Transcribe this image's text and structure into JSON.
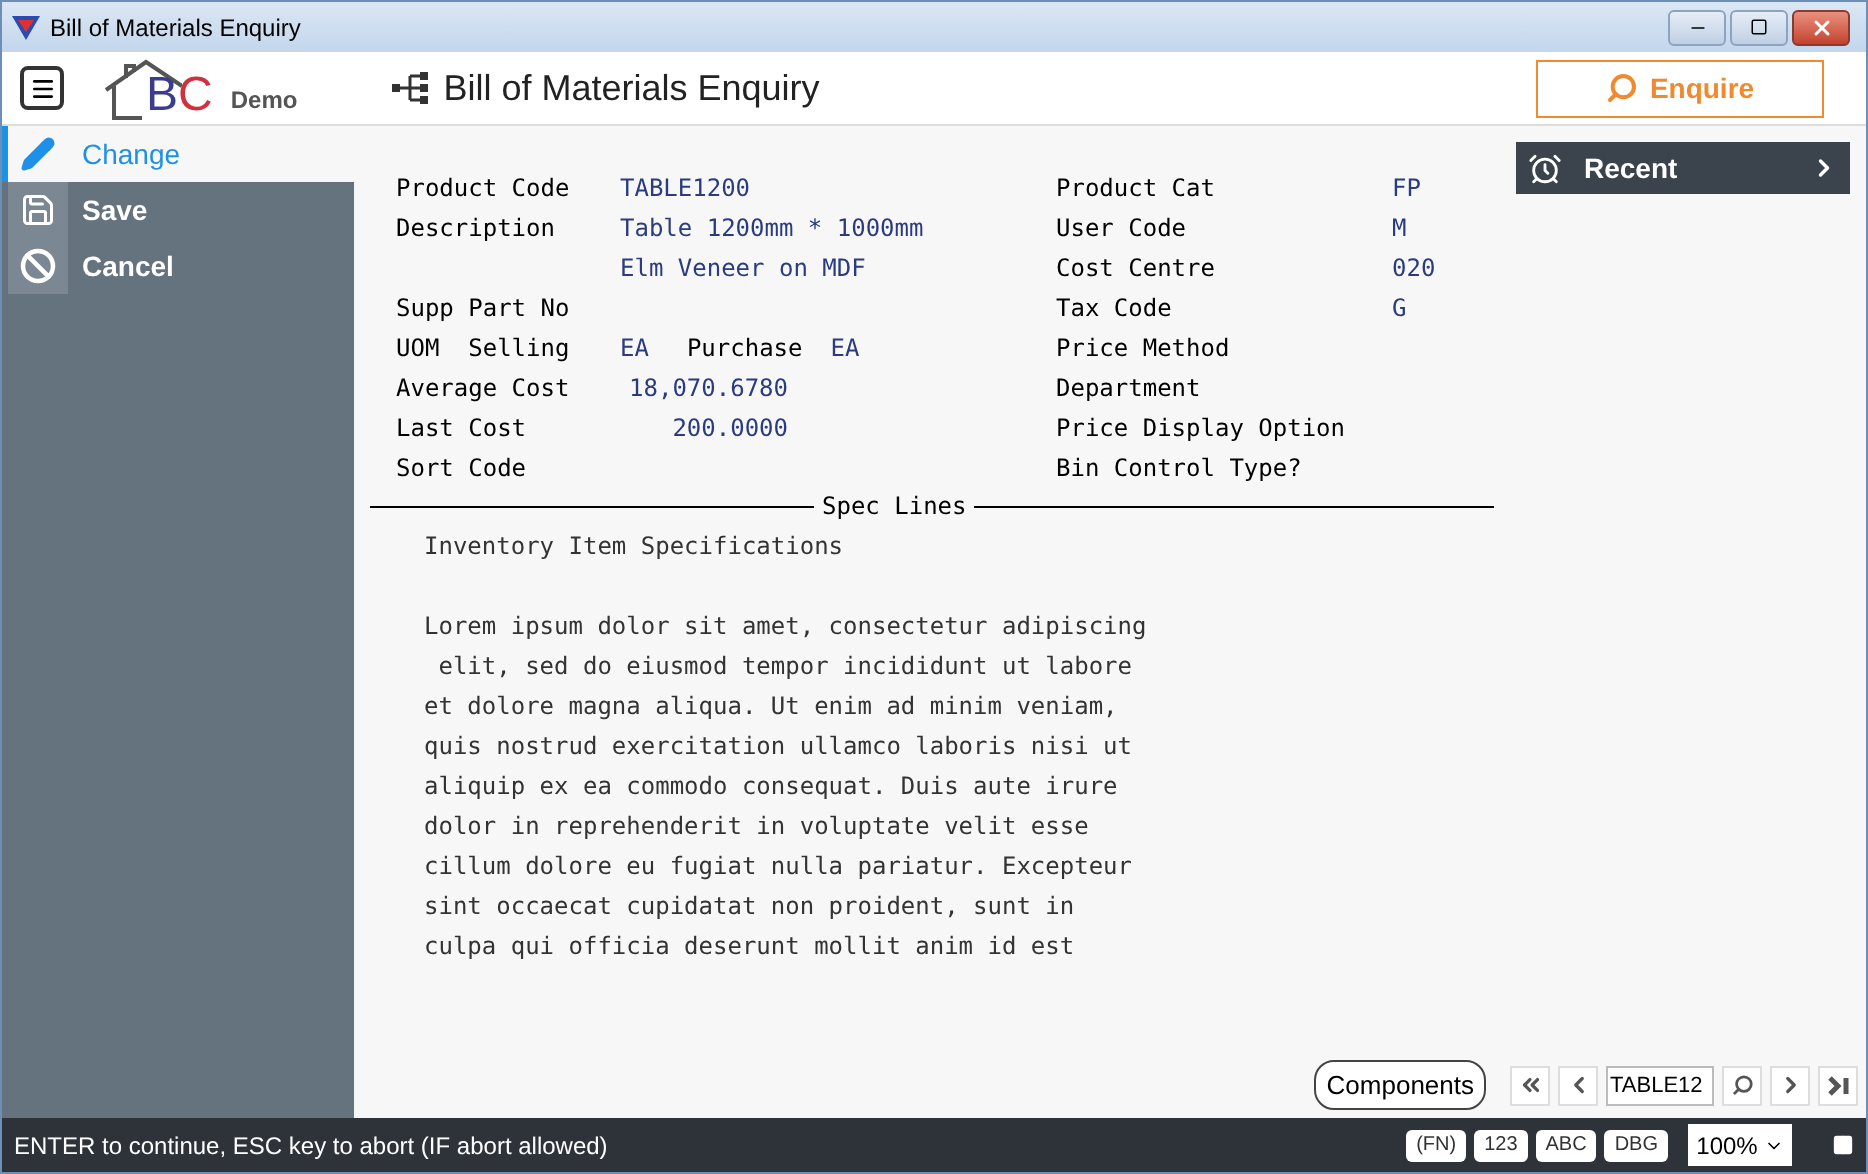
{
  "window": {
    "title": "Bill of Materials Enquiry"
  },
  "header": {
    "logo_text": "BC",
    "logo_caption": "Demo",
    "page_title": "Bill of Materials Enquiry",
    "enquire_button": "Enquire"
  },
  "sidebar": {
    "items": [
      {
        "label": "Change",
        "selected": true
      },
      {
        "label": "Save",
        "selected": false
      },
      {
        "label": "Cancel",
        "selected": false
      }
    ]
  },
  "fields_left": [
    {
      "label": "Product Code",
      "values": [
        "TABLE1200"
      ]
    },
    {
      "label": "Description",
      "values": [
        "Table 1200mm * 1000mm",
        "Elm Veneer on MDF"
      ]
    },
    {
      "label": "Supp Part No"
    },
    {
      "label": "UOM  Selling",
      "values": [
        "EA"
      ],
      "second_label": "Purchase",
      "second_value": "EA"
    },
    {
      "kind": "number",
      "label": "Average Cost",
      "values": [
        "18,070.6780"
      ]
    },
    {
      "kind": "number",
      "label": "Last Cost",
      "values": [
        "200.0000"
      ]
    },
    {
      "label": "Sort Code"
    }
  ],
  "fields_right": [
    {
      "label": "Product Cat",
      "value": "FP"
    },
    {
      "label": "User Code",
      "value": "M"
    },
    {
      "label": "Cost Centre",
      "value": "020"
    },
    {
      "label": "Tax Code",
      "value": "G"
    },
    {
      "label": "Price Method"
    },
    {
      "label": "Department"
    },
    {
      "label": "Price Display Option"
    },
    {
      "label": "Bin Control Type?"
    }
  ],
  "spec": {
    "title": "Spec Lines",
    "heading": "Inventory Item Specifications",
    "lines": [
      "Lorem ipsum dolor sit amet, consectetur adipiscing",
      " elit, sed do eiusmod tempor incididunt ut labore",
      "et dolore magna aliqua. Ut enim ad minim veniam,",
      "quis nostrud exercitation ullamco laboris nisi ut",
      "aliquip ex ea commodo consequat. Duis aute irure",
      "dolor in reprehenderit in voluptate velit esse",
      "cillum dolore eu fugiat nulla pariatur. Excepteur",
      "sint occaecat cupidatat non proident, sunt in",
      "culpa qui officia deserunt mollit anim id est"
    ]
  },
  "recent": {
    "label": "Recent"
  },
  "footer": {
    "components_button": "Components",
    "record_field": {
      "value": "TABLE12"
    }
  },
  "status_bar": {
    "message": "ENTER to continue, ESC key to abort (IF abort allowed)",
    "badges": [
      "(FN)",
      "123",
      "ABC",
      "DBG"
    ],
    "zoom": "100%"
  }
}
